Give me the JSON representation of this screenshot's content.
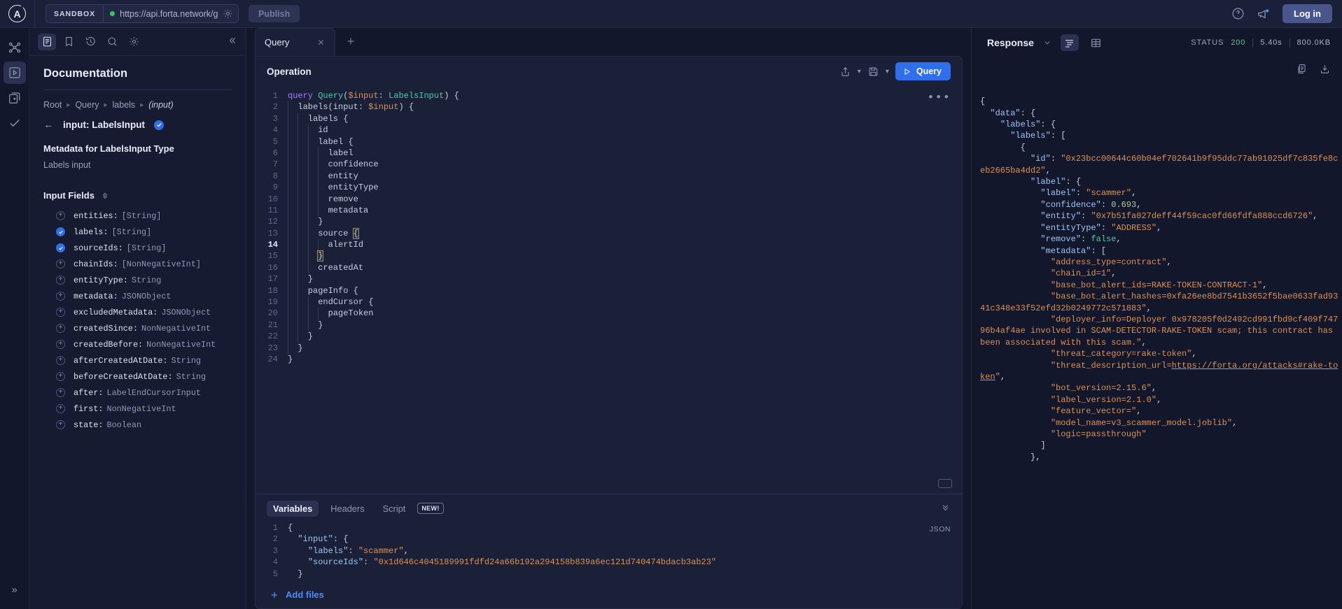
{
  "topbar": {
    "logo_letter": "A",
    "sandbox_label": "SANDBOX",
    "url_value": "https://api.forta.network/gr",
    "url_placeholder": "https://",
    "publish_label": "Publish",
    "login_label": "Log in",
    "icons": [
      "help-icon",
      "announcements-icon"
    ]
  },
  "rail": {
    "items": [
      {
        "name": "graph-icon",
        "active": false
      },
      {
        "name": "play-icon",
        "active": true
      },
      {
        "name": "collection-icon",
        "active": false
      },
      {
        "name": "check-icon",
        "active": false
      }
    ],
    "expand_label": "»"
  },
  "docs": {
    "tabs": [
      "docs-icon",
      "bookmark-icon",
      "history-icon",
      "search-icon",
      "settings-icon"
    ],
    "collapse_icon": "chevron-double-left-icon",
    "title": "Documentation",
    "breadcrumb": [
      "Root",
      "Query",
      "labels",
      "(input)"
    ],
    "type_name": "input: LabelsInput",
    "meta_title": "Metadata for LabelsInput Type",
    "meta_desc": "Labels input",
    "fields_header": "Input Fields",
    "fields": [
      {
        "name": "entities:",
        "type": "[String]",
        "selected": false
      },
      {
        "name": "labels:",
        "type": "[String]",
        "selected": true
      },
      {
        "name": "sourceIds:",
        "type": "[String]",
        "selected": true
      },
      {
        "name": "chainIds:",
        "type": "[NonNegativeInt]",
        "selected": false
      },
      {
        "name": "entityType:",
        "type": "String",
        "selected": false
      },
      {
        "name": "metadata:",
        "type": "JSONObject",
        "selected": false
      },
      {
        "name": "excludedMetadata:",
        "type": "JSONObject",
        "selected": false
      },
      {
        "name": "createdSince:",
        "type": "NonNegativeInt",
        "selected": false
      },
      {
        "name": "createdBefore:",
        "type": "NonNegativeInt",
        "selected": false
      },
      {
        "name": "afterCreatedAtDate:",
        "type": "String",
        "selected": false
      },
      {
        "name": "beforeCreatedAtDate:",
        "type": "String",
        "selected": false
      },
      {
        "name": "after:",
        "type": "LabelEndCursorInput",
        "selected": false
      },
      {
        "name": "first:",
        "type": "NonNegativeInt",
        "selected": false
      },
      {
        "name": "state:",
        "type": "Boolean",
        "selected": false
      }
    ]
  },
  "editor": {
    "tab_label": "Query",
    "close_icon": "close-icon",
    "new_tab_icon": "plus-icon",
    "operation_title": "Operation",
    "tools": [
      "share-icon",
      "save-icon"
    ],
    "run_label": "Query",
    "active_line": 14,
    "lines": [
      "query Query($input: LabelsInput) {",
      "  labels(input: $input) {",
      "    labels {",
      "      id",
      "      label {",
      "        label",
      "        confidence",
      "        entity",
      "        entityType",
      "        remove",
      "        metadata",
      "      }",
      "      source {",
      "        alertId",
      "      }",
      "      createdAt",
      "    }",
      "    pageInfo {",
      "      endCursor {",
      "        pageToken",
      "      }",
      "    }",
      "  }",
      "}"
    ]
  },
  "variables": {
    "tabs": [
      "Variables",
      "Headers",
      "Script"
    ],
    "active_tab": "Variables",
    "new_badge": "NEW!",
    "format_label": "JSON",
    "collapse_icon": "chevron-double-down-icon",
    "lines": [
      "{",
      "  \"input\": {",
      "    \"labels\": \"scammer\",",
      "    \"sourceIds\": \"0x1d646c4045189991fdfd24a66b192a294158b839a6ec121d740474bdacb3ab23\"",
      "  }"
    ],
    "add_files_label": "Add files",
    "add_files_icon": "plus-icon"
  },
  "response": {
    "title": "Response",
    "dropdown_icon": "chevron-down-icon",
    "view_icons": [
      "pretty-view-icon",
      "table-view-icon"
    ],
    "status_label": "STATUS",
    "status_code": "200",
    "time": "5.40s",
    "size": "800.0KB",
    "actions": [
      "copy-icon",
      "download-icon"
    ],
    "link_url": "https://forta.org/attacks#rake-token",
    "json_lines": [
      "{",
      "  \"data\": {",
      "    \"labels\": {",
      "      \"labels\": [",
      "        {",
      "          \"id\": \"0x23bcc00644c60b04ef702641b9f95ddc77ab91025df7c835fe8ceb2665ba4dd2\",",
      "          \"label\": {",
      "            \"label\": \"scammer\",",
      "            \"confidence\": 0.693,",
      "            \"entity\": \"0x7b51fa027deff44f59cac0fd66fdfa888ccd6726\",",
      "            \"entityType\": \"ADDRESS\",",
      "            \"remove\": false,",
      "            \"metadata\": [",
      "              \"address_type=contract\",",
      "              \"chain_id=1\",",
      "              \"base_bot_alert_ids=RAKE-TOKEN-CONTRACT-1\",",
      "              \"base_bot_alert_hashes=0xfa26ee8bd7541b3652f5bae0633fad9341c348e33f52efd32b0249772c571883\",",
      "              \"deployer_info=Deployer 0x978205f0d2492cd991fbd9cf409f74796b4af4ae involved in SCAM-DETECTOR-RAKE-TOKEN scam; this contract has been associated with this scam.\",",
      "              \"threat_category=rake-token\",",
      "              \"threat_description_url=https://forta.org/attacks#rake-token\",",
      "              \"bot_version=2.15.6\",",
      "              \"label_version=2.1.0\",",
      "              \"feature_vector=\",",
      "              \"model_name=v3_scammer_model.joblib\",",
      "              \"logic=passthrough\"",
      "            ]",
      "          },"
    ]
  }
}
